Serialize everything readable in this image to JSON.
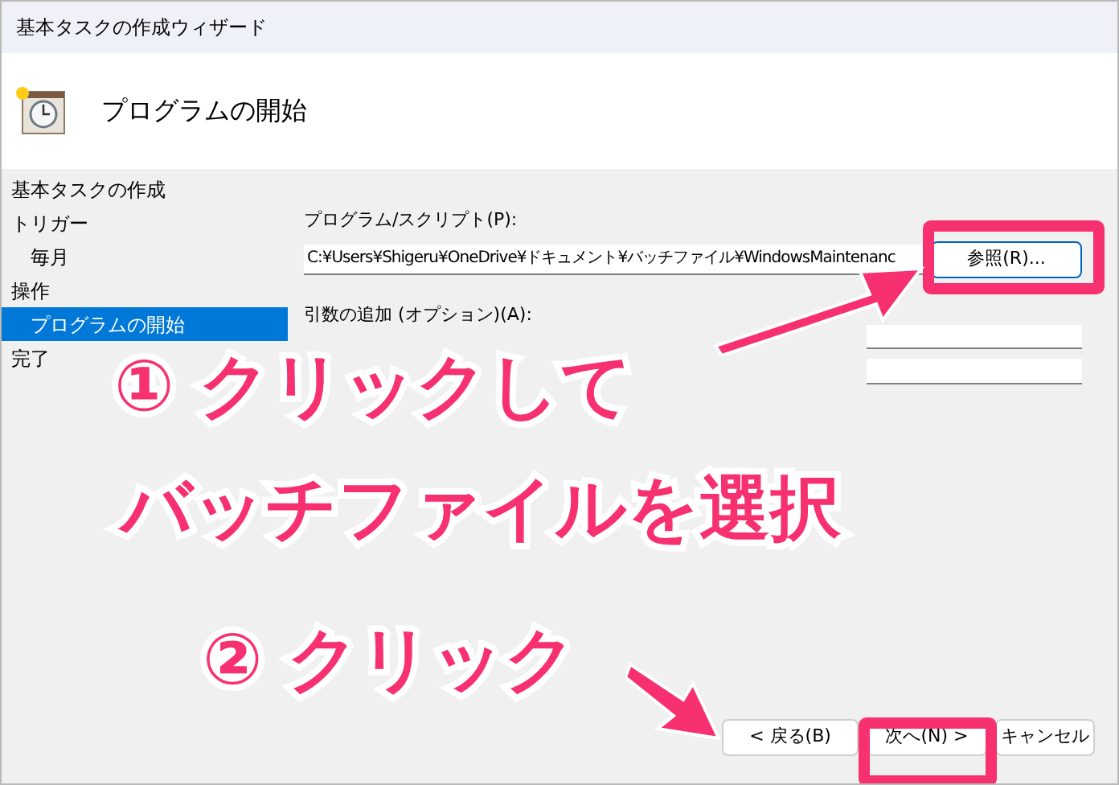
{
  "window": {
    "title": "基本タスクの作成ウィザード"
  },
  "header": {
    "title": "プログラムの開始"
  },
  "nav": [
    {
      "label": "基本タスクの作成",
      "selected": false
    },
    {
      "label": "トリガー",
      "selected": false,
      "children": [
        {
          "label": "毎月",
          "selected": false
        }
      ]
    },
    {
      "label": "操作",
      "selected": false,
      "children": [
        {
          "label": "プログラムの開始",
          "selected": true
        }
      ]
    },
    {
      "label": "完了",
      "selected": false
    }
  ],
  "form": {
    "program_label": "プログラム/スクリプト(P):",
    "program_value": "C:¥Users¥Shigeru¥OneDrive¥ドキュメント¥バッチファイル¥WindowsMaintenanc",
    "browse_button": "参照(R)...",
    "arguments_label": "引数の追加 (オプション)(A):"
  },
  "buttons": [
    {
      "label": "< 戻る(B)"
    },
    {
      "label": "次へ(N) >"
    },
    {
      "label": "キャンセル"
    }
  ],
  "callouts": [
    "① クリックして",
    "バッチファイルを選択",
    "② クリック"
  ]
}
